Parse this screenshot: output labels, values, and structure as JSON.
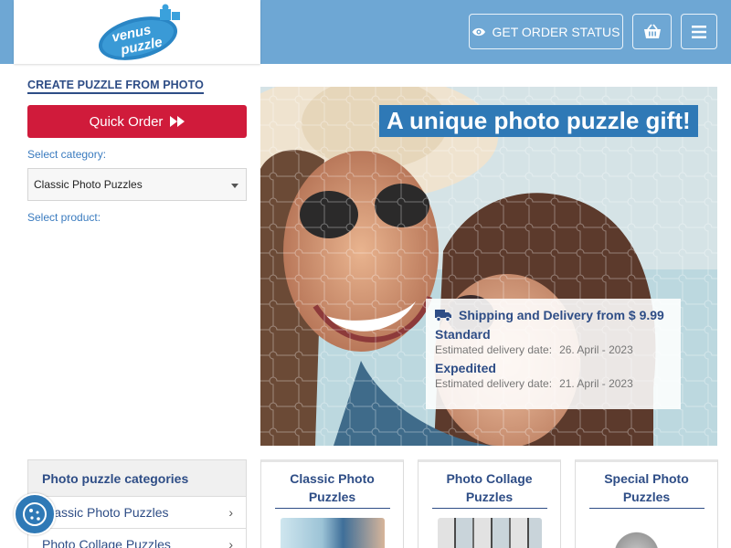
{
  "header": {
    "logo_text_line1": "venus",
    "logo_text_line2": "puzzle",
    "order_status_label": "GET ORDER STATUS"
  },
  "sidebar": {
    "create_title": "CREATE PUZZLE FROM PHOTO",
    "quick_order_label": "Quick Order",
    "select_category_label": "Select category:",
    "selected_category": "Classic Photo Puzzles",
    "select_product_label": "Select product:"
  },
  "hero": {
    "title": "A unique photo puzzle gift!",
    "shipping_heading": "Shipping and Delivery from $ 9.99",
    "standard_label": "Standard",
    "standard_est_label": "Estimated delivery date:",
    "standard_date": "26. April - 2023",
    "expedited_label": "Expedited",
    "expedited_est_label": "Estimated delivery date:",
    "expedited_date": "21. April - 2023"
  },
  "categories": {
    "heading": "Photo puzzle categories",
    "items": [
      {
        "label": "Classic Photo Puzzles"
      },
      {
        "label": "Photo Collage Puzzles"
      }
    ]
  },
  "cards": [
    {
      "title": "Classic Photo Puzzles"
    },
    {
      "title": "Photo Collage Puzzles"
    },
    {
      "title": "Special Photo Puzzles"
    }
  ],
  "colors": {
    "header_bg": "#6ea7d4",
    "brand_blue": "#2e4d86",
    "accent_red": "#d01b3b",
    "hero_title_bg": "#2f79b6"
  },
  "icons": {
    "order_status": "eye-icon",
    "basket": "basket-icon",
    "menu": "hamburger-menu-icon",
    "quick_order": "fast-forward-icon",
    "shipping": "truck-icon",
    "chevron": "chevron-right-icon",
    "cookie": "cookie-icon"
  }
}
